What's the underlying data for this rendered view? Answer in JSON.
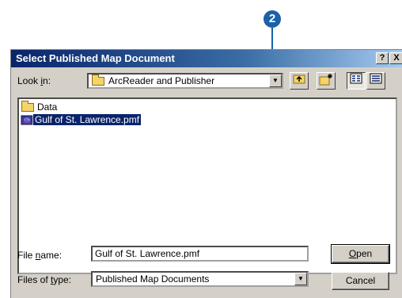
{
  "callout": {
    "number": "2"
  },
  "dialog": {
    "title": "Select Published Map Document",
    "help_button": "?",
    "close_button": "X"
  },
  "look_in": {
    "label_prefix": "Look ",
    "label_access": "i",
    "label_suffix": "n:",
    "value": "ArcReader and Publisher"
  },
  "toolbar": {
    "up_icon": "up-one-level-icon",
    "new_folder_icon": "new-folder-icon",
    "list_icon": "list-view-icon",
    "details_icon": "details-view-icon"
  },
  "files": [
    {
      "name": "Data",
      "type": "folder",
      "selected": false
    },
    {
      "name": "Gulf of St. Lawrence.pmf",
      "type": "map-document",
      "selected": true
    }
  ],
  "file_name": {
    "label_prefix": "File ",
    "label_access": "n",
    "label_suffix": "ame:",
    "value": "Gulf of St. Lawrence.pmf"
  },
  "files_of_type": {
    "label_prefix": "Files of ",
    "label_access": "t",
    "label_suffix": "ype:",
    "value": "Published Map Documents"
  },
  "buttons": {
    "open_access": "O",
    "open_rest": "pen",
    "cancel": "Cancel"
  },
  "colors": {
    "titlebar": "#0a246a",
    "callout": "#1a62a8",
    "dialog_bg": "#d4d0c8"
  }
}
